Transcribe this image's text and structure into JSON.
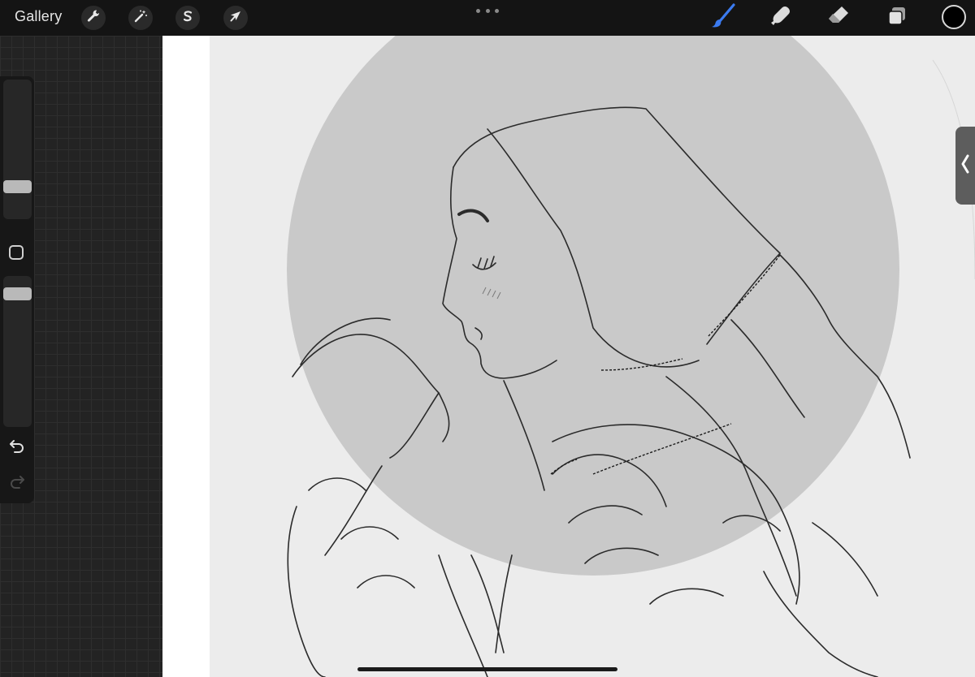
{
  "toolbar": {
    "gallery_label": "Gallery",
    "left_tools": [
      {
        "name": "actions",
        "icon": "wrench-icon"
      },
      {
        "name": "adjustments",
        "icon": "magic-wand-icon"
      },
      {
        "name": "selection",
        "icon": "selection-s-icon"
      },
      {
        "name": "transform",
        "icon": "arrow-cursor-icon"
      }
    ],
    "more_icon": "more-dots-icon",
    "right_tools": [
      {
        "name": "brush",
        "icon": "brush-icon",
        "active": true
      },
      {
        "name": "smudge",
        "icon": "smudge-finger-icon",
        "active": false
      },
      {
        "name": "eraser",
        "icon": "eraser-icon",
        "active": false
      },
      {
        "name": "layers",
        "icon": "layers-icon",
        "active": false
      }
    ],
    "current_color": "#000000",
    "accent_color": "#3b7bf0"
  },
  "sidebar": {
    "brush_size_level": 0.72,
    "brush_opacity_level": 0.88,
    "undo_icon": "undo-icon",
    "redo_icon": "redo-icon",
    "modify_icon": "square-modify-icon"
  },
  "canvas": {
    "background_panel": "#ececec",
    "circle_fill": "#c9c9c9",
    "stroke_color": "#2b2b2b"
  }
}
